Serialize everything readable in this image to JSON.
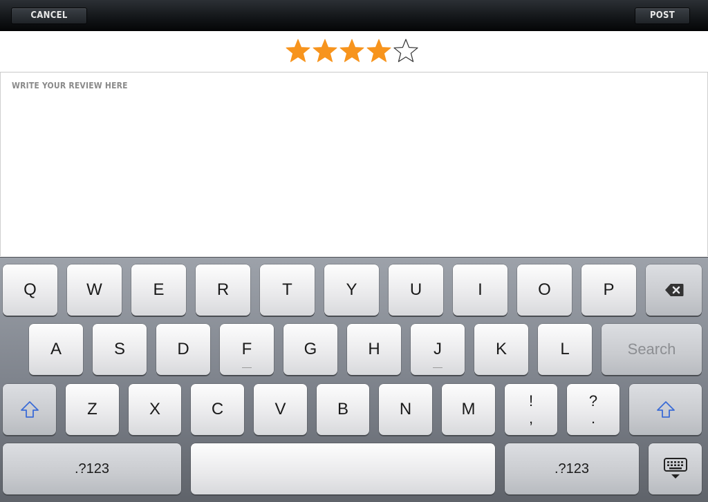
{
  "toolbar": {
    "cancel_label": "CANCEL",
    "post_label": "POST"
  },
  "rating": {
    "value": 4,
    "max": 5,
    "filled_color": "#f7941d",
    "empty_color": "#ffffff"
  },
  "review": {
    "placeholder": "WRITE YOUR REVIEW HERE"
  },
  "keyboard": {
    "row1": [
      "Q",
      "W",
      "E",
      "R",
      "T",
      "Y",
      "U",
      "I",
      "O",
      "P"
    ],
    "row2": [
      "A",
      "S",
      "D",
      "F",
      "G",
      "H",
      "J",
      "K",
      "L"
    ],
    "search_label": "Search",
    "row3": [
      "Z",
      "X",
      "C",
      "V",
      "B",
      "N",
      "M"
    ],
    "punct1": {
      "top": "!",
      "bottom": ","
    },
    "punct2": {
      "top": "?",
      "bottom": "."
    },
    "numbers_label": ".?123",
    "icons": {
      "backspace": "backspace-icon",
      "shift": "shift-icon",
      "dismiss": "keyboard-dismiss-icon"
    },
    "shift_color": "#3a6bd6"
  }
}
